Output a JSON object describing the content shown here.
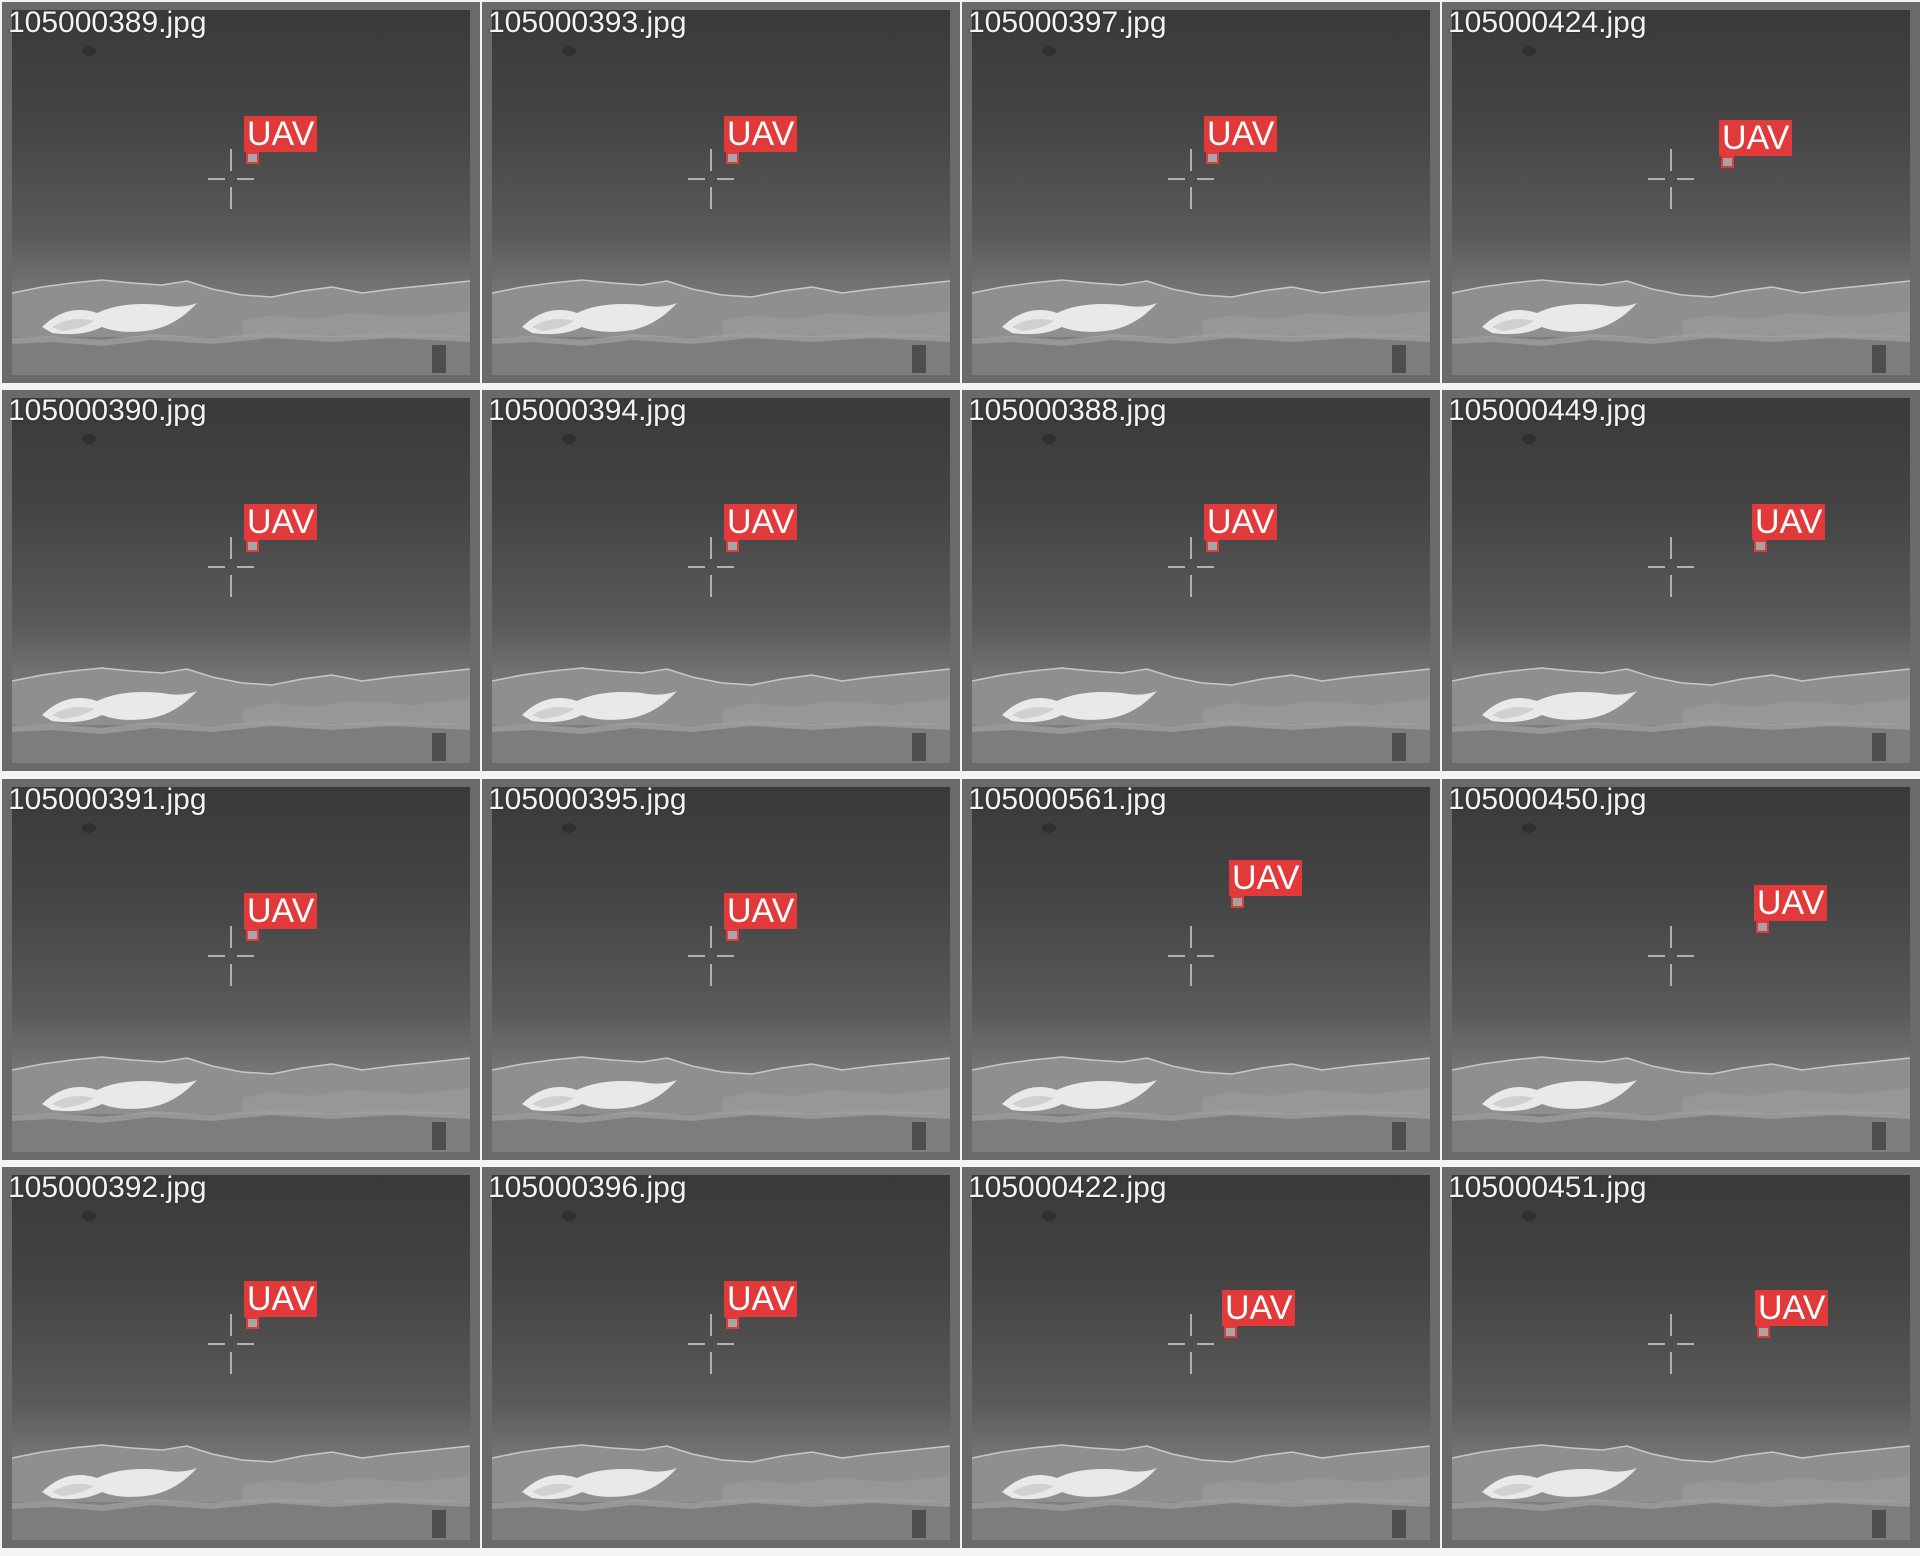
{
  "tiles": [
    {
      "filename": "105000389.jpg",
      "label": "UAV"
    },
    {
      "filename": "105000393.jpg",
      "label": "UAV"
    },
    {
      "filename": "105000397.jpg",
      "label": "UAV"
    },
    {
      "filename": "105000424.jpg",
      "label": "UAV"
    },
    {
      "filename": "105000390.jpg",
      "label": "UAV"
    },
    {
      "filename": "105000394.jpg",
      "label": "UAV"
    },
    {
      "filename": "105000388.jpg",
      "label": "UAV"
    },
    {
      "filename": "105000449.jpg",
      "label": "UAV"
    },
    {
      "filename": "105000391.jpg",
      "label": "UAV"
    },
    {
      "filename": "105000395.jpg",
      "label": "UAV"
    },
    {
      "filename": "105000561.jpg",
      "label": "UAV"
    },
    {
      "filename": "105000450.jpg",
      "label": "UAV"
    },
    {
      "filename": "105000392.jpg",
      "label": "UAV"
    },
    {
      "filename": "105000396.jpg",
      "label": "UAV"
    },
    {
      "filename": "105000422.jpg",
      "label": "UAV"
    },
    {
      "filename": "105000451.jpg",
      "label": "UAV"
    }
  ],
  "colors": {
    "label_background": "#e23a3a",
    "label_text": "#ffffff"
  }
}
